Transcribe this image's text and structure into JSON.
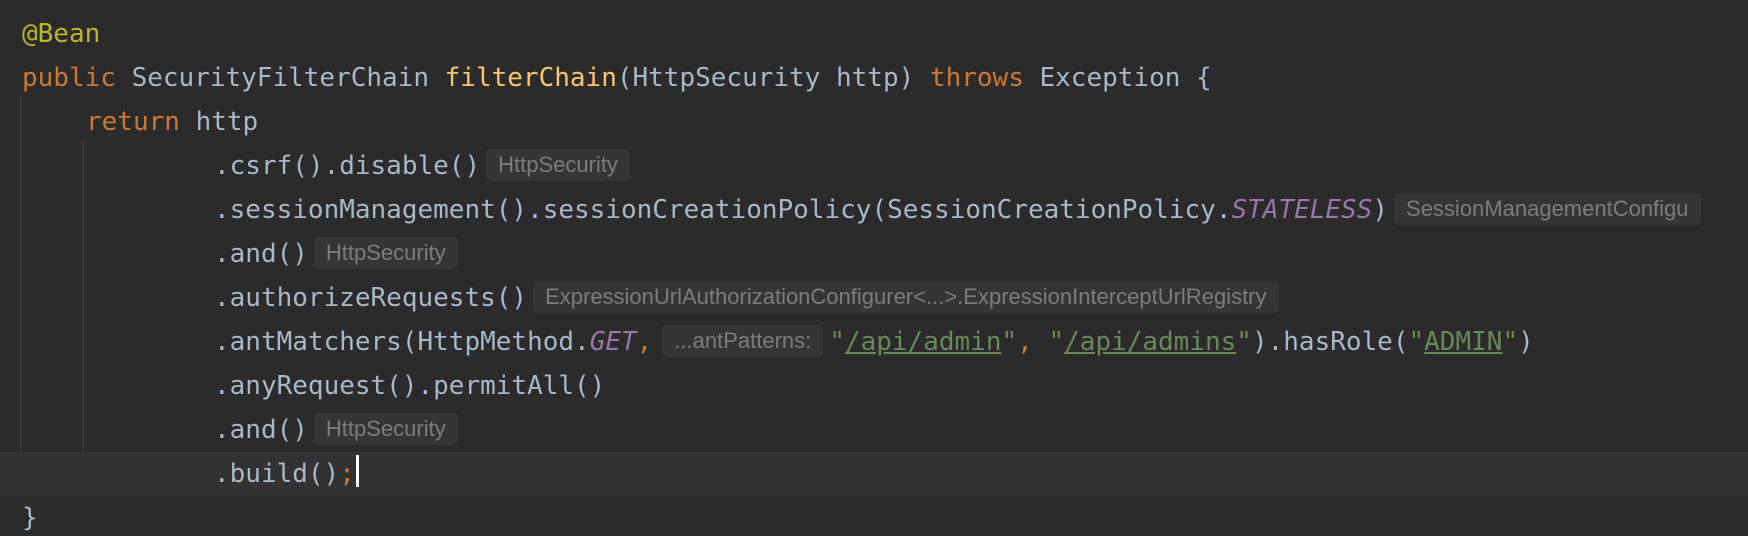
{
  "editor": {
    "theme": "dark",
    "colors": {
      "background": "#2b2b2b",
      "current_line": "#323232",
      "keyword": "#cc7832",
      "annotation": "#bbb529",
      "method_declaration": "#ffc66d",
      "constant": "#9876aa",
      "string": "#6a8759",
      "plain": "#a9b7c6",
      "inlay_hint": "#7c7c7c"
    },
    "annotation": "@Bean",
    "signature": {
      "modifier": "public",
      "return_type": "SecurityFilterChain",
      "method_name": "filterChain",
      "params": "(HttpSecurity http)",
      "throws_kw": "throws",
      "exception": "Exception {"
    },
    "return_kw": "return",
    "return_target": "http",
    "chain": {
      "csrf": ".csrf().disable()",
      "csrf_hint": "HttpSecurity",
      "session_prefix": ".sessionManagement().sessionCreationPolicy(SessionCreationPolicy.",
      "session_const": "STATELESS",
      "session_suffix": ")",
      "session_hint": "SessionManagementConfigu",
      "and1": ".and()",
      "and1_hint": "HttpSecurity",
      "authorize": ".authorizeRequests()",
      "authorize_hint": "ExpressionUrlAuthorizationConfigurer<...>.ExpressionInterceptUrlRegistry",
      "ant_prefix": ".antMatchers(HttpMethod.",
      "ant_const": "GET",
      "ant_comma": ",",
      "ant_param_hint": "...antPatterns:",
      "ant_str1": "/api/admin",
      "ant_str2": "/api/admins",
      "ant_role_call": ").hasRole(",
      "ant_role": "ADMIN",
      "any_request": ".anyRequest().permitAll()",
      "and2": ".and()",
      "and2_hint": "HttpSecurity",
      "build": ".build()",
      "build_semicolon": ";"
    },
    "closing_brace": "}"
  }
}
